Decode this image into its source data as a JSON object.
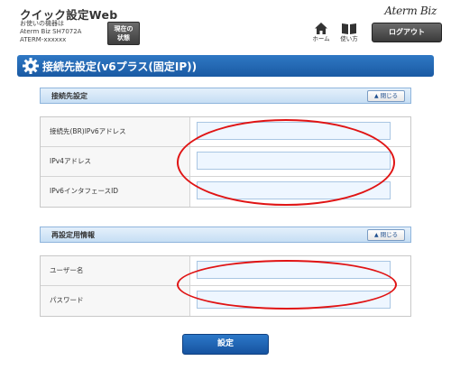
{
  "header": {
    "app_title": "クイック設定Web",
    "device_label": "お使いの機器は",
    "device_model": "Aterm Biz SH7072A",
    "device_name": "ATERM-xxxxxx",
    "status_button": "現在の状態",
    "nav_home": "ホーム",
    "nav_manual": "使い方",
    "brand": "Aterm Biz",
    "logout_button": "ログアウト"
  },
  "page": {
    "title": "接続先設定(v6プラス(固定IP))"
  },
  "section_connection": {
    "title": "接続先設定",
    "close_label": "閉じる",
    "rows": [
      {
        "label": "接続先(BR)IPv6アドレス",
        "value": ""
      },
      {
        "label": "IPv4アドレス",
        "value": ""
      },
      {
        "label": "IPv6インタフェースID",
        "value": ""
      }
    ]
  },
  "section_reset": {
    "title": "再設定用情報",
    "close_label": "閉じる",
    "rows": [
      {
        "label": "ユーザー名",
        "value": ""
      },
      {
        "label": "パスワード",
        "value": ""
      }
    ]
  },
  "submit_button": "設定",
  "colors": {
    "accent_blue": "#1a5aa3",
    "annotation_red": "#e01414",
    "input_bg": "#eef6ff"
  }
}
